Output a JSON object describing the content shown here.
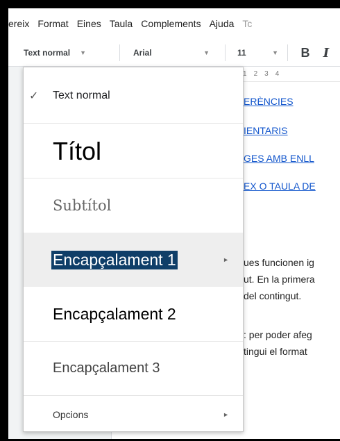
{
  "menubar": {
    "items": [
      "ereix",
      "Format",
      "Eines",
      "Taula",
      "Complements",
      "Ajuda",
      "Tc"
    ]
  },
  "toolbar": {
    "style_value": "Text normal",
    "font_value": "Arial",
    "size_value": "11",
    "bold_label": "B",
    "italic_label": "I"
  },
  "ruler": {
    "marks": [
      "1",
      "2",
      "3",
      "4"
    ]
  },
  "document": {
    "links": [
      "ERÈNCIES",
      "IENTARIS",
      "GES AMB ENLL",
      "EX O TAULA DE"
    ],
    "lines": [
      "ues funcionen ig",
      "ut. En la primera",
      "del contingut.",
      ": per poder afeg",
      "tingui el format"
    ]
  },
  "style_menu": {
    "items": [
      {
        "label": "Text normal",
        "checked": true
      },
      {
        "label": "Títol"
      },
      {
        "label": "Subtítol"
      },
      {
        "label": "Encapçalament 1",
        "highlighted": true,
        "has_submenu": true
      },
      {
        "label": "Encapçalament 2"
      },
      {
        "label": "Encapçalament 3"
      }
    ],
    "options_label": "Opcions",
    "check_icon": "✓",
    "submenu_arrow": "►"
  }
}
